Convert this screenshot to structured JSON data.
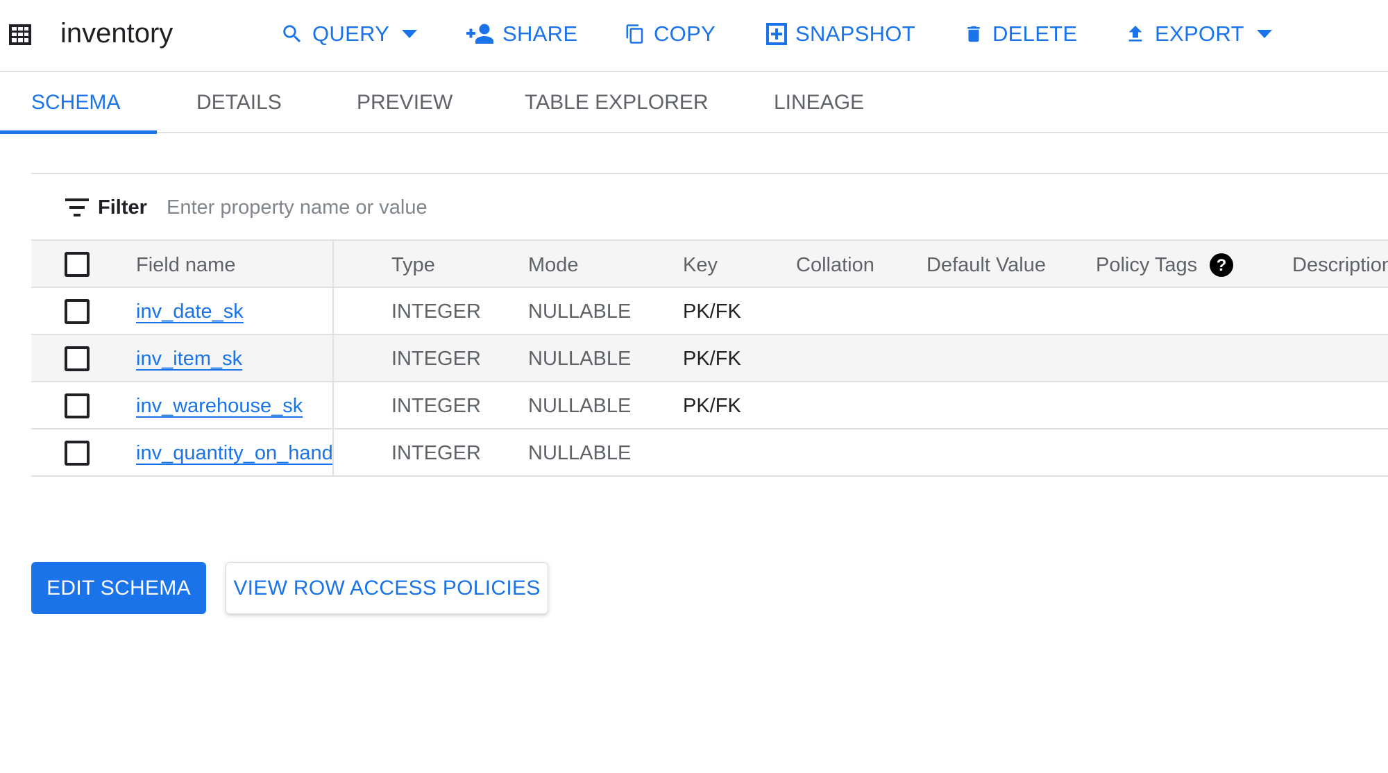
{
  "app": {
    "title": "inventory"
  },
  "toolbar": {
    "query": "QUERY",
    "share": "SHARE",
    "copy": "COPY",
    "snapshot": "SNAPSHOT",
    "delete": "DELETE",
    "export": "EXPORT"
  },
  "tabs": [
    {
      "label": "SCHEMA",
      "active": true
    },
    {
      "label": "DETAILS",
      "active": false
    },
    {
      "label": "PREVIEW",
      "active": false
    },
    {
      "label": "TABLE EXPLORER",
      "active": false
    },
    {
      "label": "LINEAGE",
      "active": false
    }
  ],
  "filter": {
    "label": "Filter",
    "placeholder": "Enter property name or value",
    "value": ""
  },
  "table": {
    "headers": {
      "field_name": "Field name",
      "type": "Type",
      "mode": "Mode",
      "key": "Key",
      "collation": "Collation",
      "default_value": "Default Value",
      "policy_tags": "Policy Tags",
      "description": "Description"
    },
    "rows": [
      {
        "field_name": "inv_date_sk",
        "type": "INTEGER",
        "mode": "NULLABLE",
        "key": "PK/FK",
        "checked": false
      },
      {
        "field_name": "inv_item_sk",
        "type": "INTEGER",
        "mode": "NULLABLE",
        "key": "PK/FK",
        "checked": false
      },
      {
        "field_name": "inv_warehouse_sk",
        "type": "INTEGER",
        "mode": "NULLABLE",
        "key": "PK/FK",
        "checked": false
      },
      {
        "field_name": "inv_quantity_on_hand",
        "type": "INTEGER",
        "mode": "NULLABLE",
        "key": "",
        "checked": false
      }
    ]
  },
  "actions": {
    "edit_schema": "EDIT SCHEMA",
    "view_row_access_policies": "VIEW ROW ACCESS POLICIES"
  },
  "colors": {
    "accent": "#1a73e8",
    "text": "#202124",
    "muted": "#5f6368",
    "border": "#e0e0e0",
    "header_bg": "#f5f5f5"
  },
  "icons": [
    "table-icon",
    "search-icon",
    "add-person-icon",
    "copy-icon",
    "snapshot-icon",
    "delete-icon",
    "upload-icon",
    "caret-down-icon",
    "filter-icon",
    "help-icon"
  ]
}
